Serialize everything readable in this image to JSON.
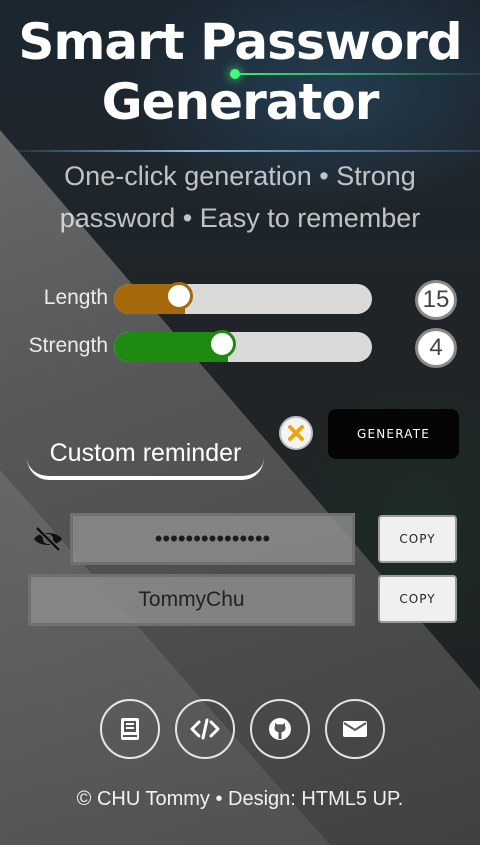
{
  "header": {
    "title_line1": "Smart Password",
    "title_line2": "Generator",
    "subtitle_line1": "One-click generation • Strong",
    "subtitle_line2": "password • Easy to remember"
  },
  "controls": {
    "length": {
      "label": "Length",
      "value": "15",
      "level": 0.25,
      "color": "#a5680a"
    },
    "strength": {
      "label": "Strength",
      "value": "4",
      "level": 0.42,
      "color": "#1e8a10"
    }
  },
  "actions": {
    "reminder_label": "Custom reminder",
    "clear_icon": "close-icon",
    "generate_label": "GENERATE"
  },
  "output": {
    "password_masked": "•••••••••••••••",
    "reminder_value": "TommyChu",
    "copy_label": "COPY",
    "visibility_icon": "eye-slash-icon"
  },
  "social_icons": [
    "book-icon",
    "code-icon",
    "github-icon",
    "envelope-icon"
  ],
  "footer": {
    "text": "© CHU Tommy • Design: HTML5 UP."
  },
  "colors": {
    "clear_accent": "#f0a30a",
    "generate_bg": "#050505"
  }
}
